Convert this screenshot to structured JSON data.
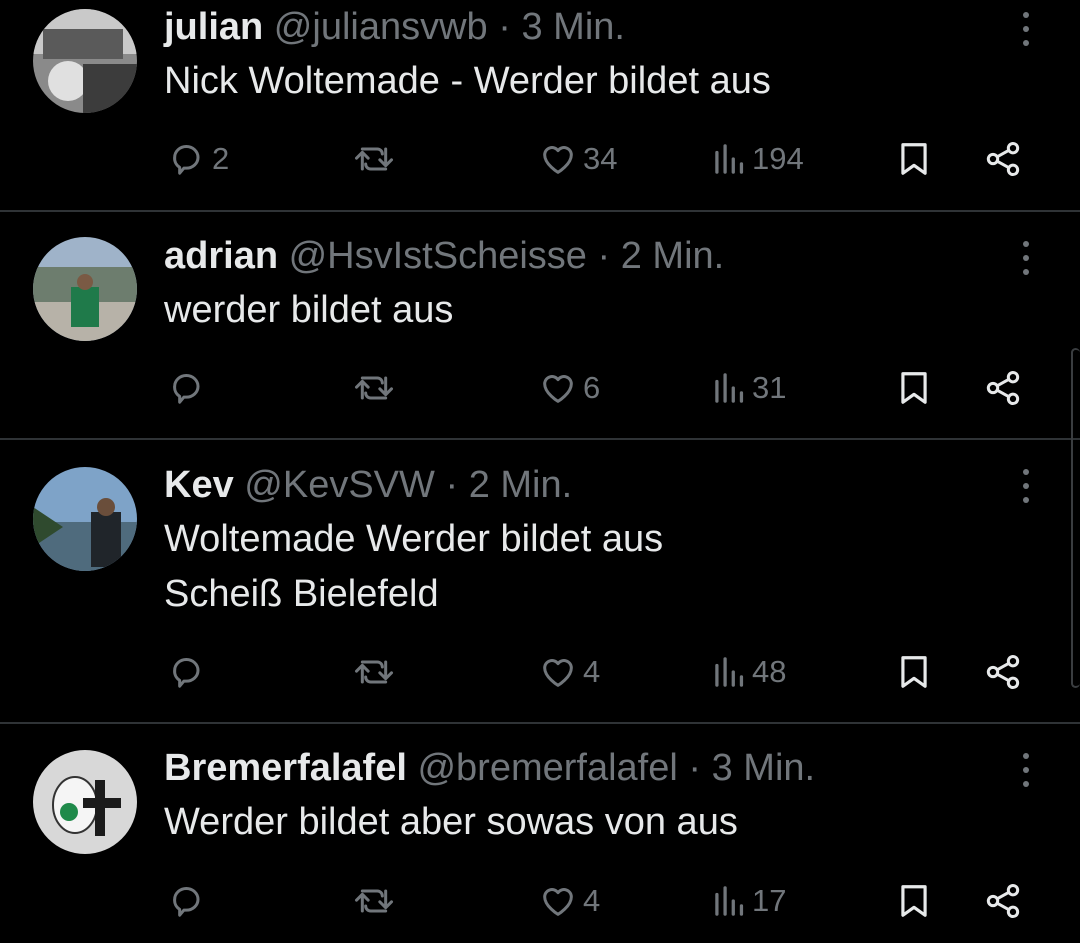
{
  "posts": [
    {
      "name": "julian",
      "handle": "@juliansvwb",
      "separator": "·",
      "time": "3 Min.",
      "text": "Nick Woltemade - Werder bildet aus",
      "replies": "2",
      "reposts": "",
      "likes": "34",
      "views": "194"
    },
    {
      "name": "adrian",
      "handle": "@HsvIstScheisse",
      "separator": "·",
      "time": "2 Min.",
      "text": "werder bildet aus",
      "replies": "",
      "reposts": "",
      "likes": "6",
      "views": "31"
    },
    {
      "name": "Kev",
      "handle": "@KevSVW",
      "separator": "·",
      "time": "2 Min.",
      "text": "Woltemade Werder bildet aus\nScheiß Bielefeld",
      "replies": "",
      "reposts": "",
      "likes": "4",
      "views": "48"
    },
    {
      "name": "Bremerfalafel",
      "handle": "@bremerfalafel",
      "separator": "·",
      "time": "3 Min.",
      "text": "Werder bildet aber sowas von aus",
      "replies": "",
      "reposts": "",
      "likes": "4",
      "views": "17"
    }
  ],
  "icons": {
    "reply": "reply-icon",
    "repost": "repost-icon",
    "like": "heart-icon",
    "views": "views-icon",
    "bookmark": "bookmark-icon",
    "share": "share-icon",
    "more": "more-icon"
  },
  "colors": {
    "background": "#000000",
    "text": "#e7e9ea",
    "muted": "#71767b",
    "separator": "#2f3336"
  }
}
